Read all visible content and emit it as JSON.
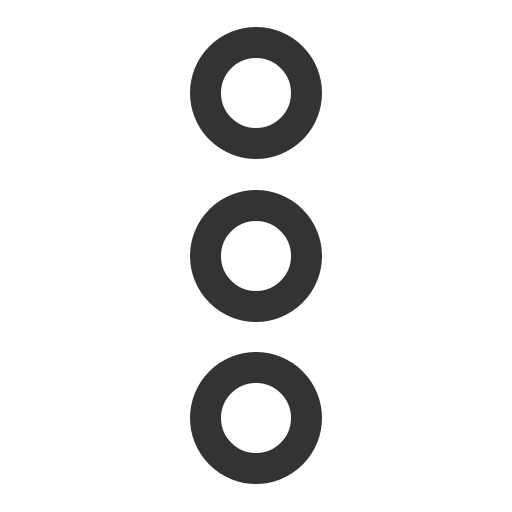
{
  "icon": {
    "name": "vertical-ellipsis-outline",
    "dot_count": 3,
    "color": "#333333",
    "background": "#ffffff"
  }
}
